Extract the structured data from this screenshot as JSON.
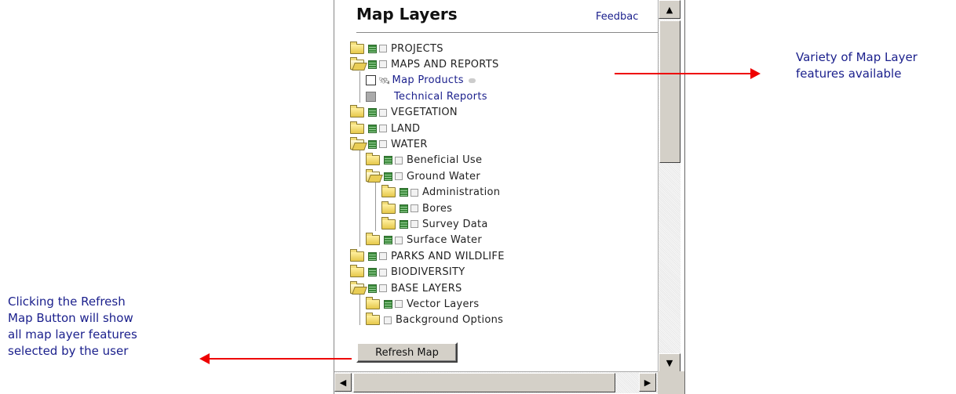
{
  "panel": {
    "title": "Map Layers",
    "feedback_label": "Feedbac",
    "refresh_label": "Refresh Map"
  },
  "tree": [
    {
      "label": "PROJECTS",
      "depth": 0,
      "open": false
    },
    {
      "label": "MAPS AND REPORTS",
      "depth": 0,
      "open": true
    },
    {
      "label": "Map Products",
      "depth": 1,
      "type": "checkbox-link"
    },
    {
      "label": "Technical Reports",
      "depth": 1,
      "type": "checkbox-link"
    },
    {
      "label": "VEGETATION",
      "depth": 0,
      "open": false
    },
    {
      "label": "LAND",
      "depth": 0,
      "open": false
    },
    {
      "label": "WATER",
      "depth": 0,
      "open": true
    },
    {
      "label": "Beneficial Use",
      "depth": 1,
      "open": false
    },
    {
      "label": "Ground Water",
      "depth": 1,
      "open": true
    },
    {
      "label": "Administration",
      "depth": 2,
      "open": false
    },
    {
      "label": "Bores",
      "depth": 2,
      "open": false
    },
    {
      "label": "Survey Data",
      "depth": 2,
      "open": false
    },
    {
      "label": "Surface Water",
      "depth": 1,
      "open": false
    },
    {
      "label": "PARKS AND WILDLIFE",
      "depth": 0,
      "open": false
    },
    {
      "label": "BIODIVERSITY",
      "depth": 0,
      "open": false
    },
    {
      "label": "BASE LAYERS",
      "depth": 0,
      "open": true
    },
    {
      "label": "Vector Layers",
      "depth": 1,
      "open": false
    },
    {
      "label": "Background Options",
      "depth": 1,
      "open": false
    }
  ],
  "annotations": {
    "right": [
      "Variety of Map Layer",
      "features available"
    ],
    "left": [
      "Clicking the Refresh",
      "Map Button will show",
      "all map layer features",
      "selected by the user"
    ]
  },
  "colors": {
    "annotation_text": "#1a1f8c",
    "arrow": "#ee0000",
    "link": "#1a1f8c"
  }
}
